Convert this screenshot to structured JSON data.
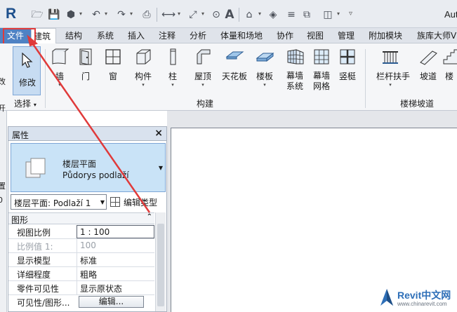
{
  "app": {
    "title": "Aut",
    "logo_letter": "R"
  },
  "quick_access": {
    "icons": [
      "open-icon",
      "save-icon",
      "model-icon",
      "undo-icon",
      "redo-icon",
      "print-icon",
      "measure-icon",
      "dimension-icon",
      "text-icon",
      "default-3d-view-icon",
      "section-icon",
      "thin-lines-icon",
      "switch-windows-icon",
      "customize-icon"
    ]
  },
  "tabs": [
    "文件",
    "建筑",
    "结构",
    "系统",
    "插入",
    "注释",
    "分析",
    "体量和场地",
    "协作",
    "视图",
    "管理",
    "附加模块",
    "族库大师V"
  ],
  "ribbon": {
    "modify_label": "修改",
    "select_label": "选择",
    "build_tools": [
      {
        "label": "墙",
        "icon": "wall-icon",
        "has_dropdown": true
      },
      {
        "label": "门",
        "icon": "door-icon",
        "has_dropdown": false
      },
      {
        "label": "窗",
        "icon": "window-icon",
        "has_dropdown": false
      },
      {
        "label": "构件",
        "icon": "component-icon",
        "has_dropdown": true
      },
      {
        "label": "柱",
        "icon": "column-icon",
        "has_dropdown": true
      },
      {
        "label": "屋顶",
        "icon": "roof-icon",
        "has_dropdown": true
      },
      {
        "label": "天花板",
        "icon": "ceiling-icon",
        "has_dropdown": false
      },
      {
        "label": "楼板",
        "icon": "floor-icon",
        "has_dropdown": true
      },
      {
        "label": "幕墙系统",
        "icon": "curtain-system-icon",
        "has_dropdown": false
      },
      {
        "label": "幕墙网格",
        "icon": "curtain-grid-icon",
        "has_dropdown": false
      },
      {
        "label": "竖梃",
        "icon": "mullion-icon",
        "has_dropdown": false
      }
    ],
    "build_panel_label": "构建",
    "circulation_tools": [
      {
        "label": "栏杆扶手",
        "icon": "railing-icon",
        "has_dropdown": true
      },
      {
        "label": "坡道",
        "icon": "ramp-icon",
        "has_dropdown": false
      },
      {
        "label": "楼",
        "icon": "stair-icon",
        "has_dropdown": false
      }
    ],
    "circulation_panel_label": "楼梯坡道"
  },
  "leftbar_chars": [
    "改",
    "开",
    "置",
    "0"
  ],
  "properties": {
    "title": "属性",
    "type_name_cn": "楼层平面",
    "type_name_cz": "Půdorys podlaží",
    "instance_select": "楼层平面: Podlaží 1",
    "edit_type_label": "编辑类型",
    "group": "图形",
    "rows": [
      {
        "key": "视图比例",
        "value": "1 : 100",
        "state": "editing"
      },
      {
        "key": "比例值 1:",
        "value": "100",
        "state": "dim"
      },
      {
        "key": "显示模型",
        "value": "标准",
        "state": "normal"
      },
      {
        "key": "详细程度",
        "value": "粗略",
        "state": "normal"
      },
      {
        "key": "零件可见性",
        "value": "显示原状态",
        "state": "normal"
      },
      {
        "key": "可见性/图形...",
        "value": "编辑...",
        "state": "button"
      }
    ]
  },
  "watermark": {
    "brand": "Revit中文网",
    "url": "www.chinarevit.com"
  },
  "colors": {
    "file_tab": "#4f82c4",
    "highlight": "#e03a3a",
    "accent_blue": "#2e6fb8"
  }
}
